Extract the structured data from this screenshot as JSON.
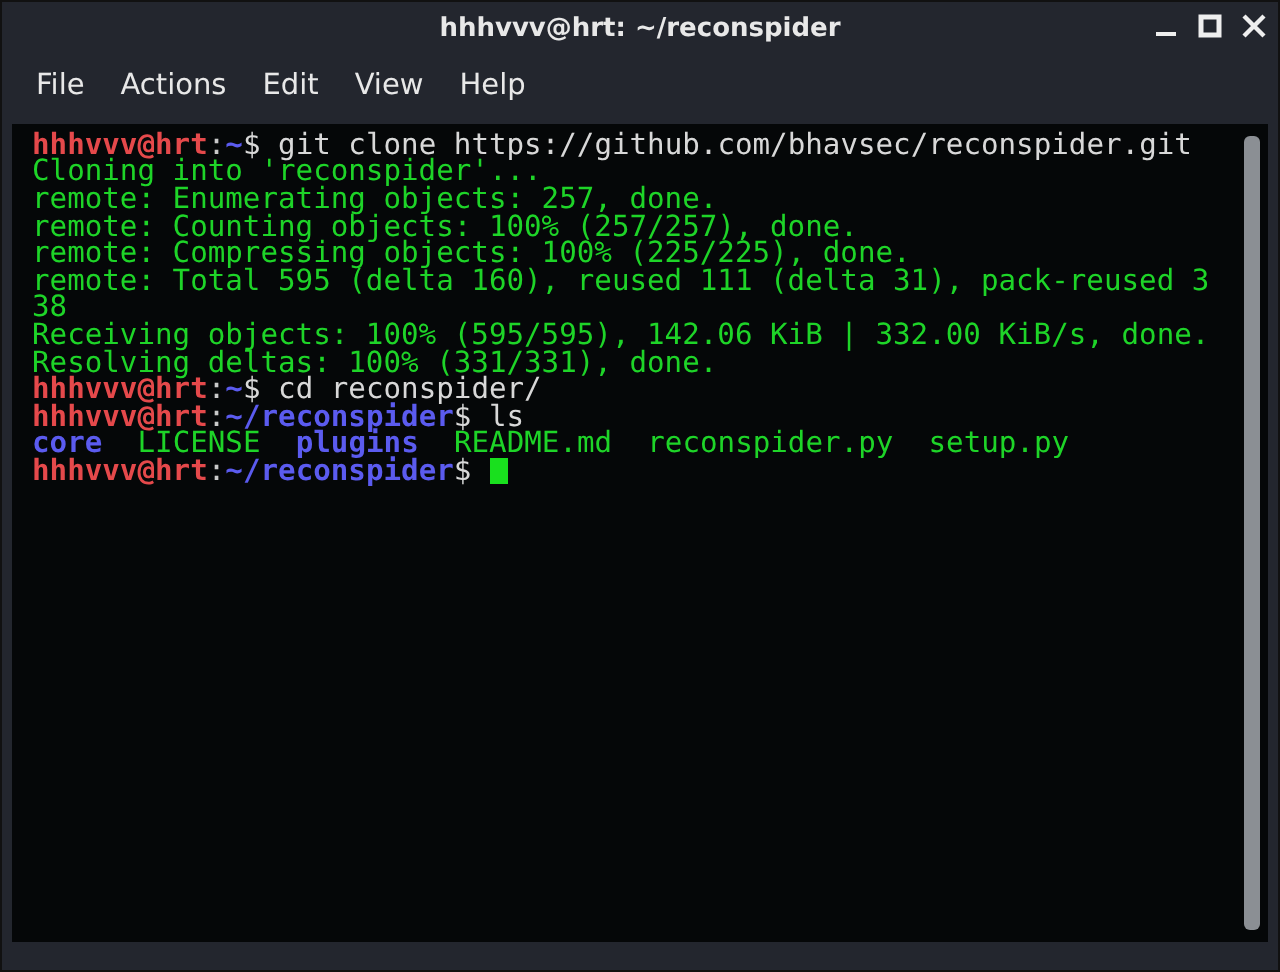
{
  "window": {
    "title": "hhhvvv@hrt: ~/reconspider"
  },
  "menu": [
    "File",
    "Actions",
    "Edit",
    "View",
    "Help"
  ],
  "terminal": {
    "lines": [
      {
        "segments": [
          {
            "kind": "user",
            "text": "hhhvvv@hrt"
          },
          {
            "kind": "sep",
            "text": ":"
          },
          {
            "kind": "path",
            "text": "~"
          },
          {
            "kind": "cmd",
            "text": "$ git clone https://github.com/bhavsec/reconspider.git"
          }
        ]
      },
      {
        "segments": [
          {
            "kind": "out",
            "text": "Cloning into 'reconspider'..."
          }
        ]
      },
      {
        "segments": [
          {
            "kind": "out",
            "text": "remote: Enumerating objects: 257, done."
          }
        ]
      },
      {
        "segments": [
          {
            "kind": "out",
            "text": "remote: Counting objects: 100% (257/257), done."
          }
        ]
      },
      {
        "segments": [
          {
            "kind": "out",
            "text": "remote: Compressing objects: 100% (225/225), done."
          }
        ]
      },
      {
        "segments": [
          {
            "kind": "out",
            "text": "remote: Total 595 (delta 160), reused 111 (delta 31), pack-reused 3"
          }
        ]
      },
      {
        "segments": [
          {
            "kind": "out",
            "text": "38"
          }
        ]
      },
      {
        "segments": [
          {
            "kind": "out",
            "text": "Receiving objects: 100% (595/595), 142.06 KiB | 332.00 KiB/s, done."
          }
        ]
      },
      {
        "segments": [
          {
            "kind": "out",
            "text": "Resolving deltas: 100% (331/331), done."
          }
        ]
      },
      {
        "segments": [
          {
            "kind": "user",
            "text": "hhhvvv@hrt"
          },
          {
            "kind": "sep",
            "text": ":"
          },
          {
            "kind": "path",
            "text": "~"
          },
          {
            "kind": "cmd",
            "text": "$ cd reconspider/"
          }
        ]
      },
      {
        "segments": [
          {
            "kind": "user",
            "text": "hhhvvv@hrt"
          },
          {
            "kind": "sep",
            "text": ":"
          },
          {
            "kind": "path",
            "text": "~/reconspider"
          },
          {
            "kind": "cmd",
            "text": "$ ls"
          }
        ]
      },
      {
        "segments": [
          {
            "kind": "dir",
            "text": "core"
          },
          {
            "kind": "file",
            "text": "LICENSE"
          },
          {
            "kind": "dir",
            "text": "plugins"
          },
          {
            "kind": "file",
            "text": "README.md"
          },
          {
            "kind": "file",
            "text": "reconspider.py"
          },
          {
            "kind": "file",
            "text": "setup.py"
          }
        ]
      },
      {
        "segments": [
          {
            "kind": "user",
            "text": "hhhvvv@hrt"
          },
          {
            "kind": "sep",
            "text": ":"
          },
          {
            "kind": "path",
            "text": "~/reconspider"
          },
          {
            "kind": "cmd",
            "text": "$"
          }
        ],
        "cursor": true
      }
    ]
  }
}
